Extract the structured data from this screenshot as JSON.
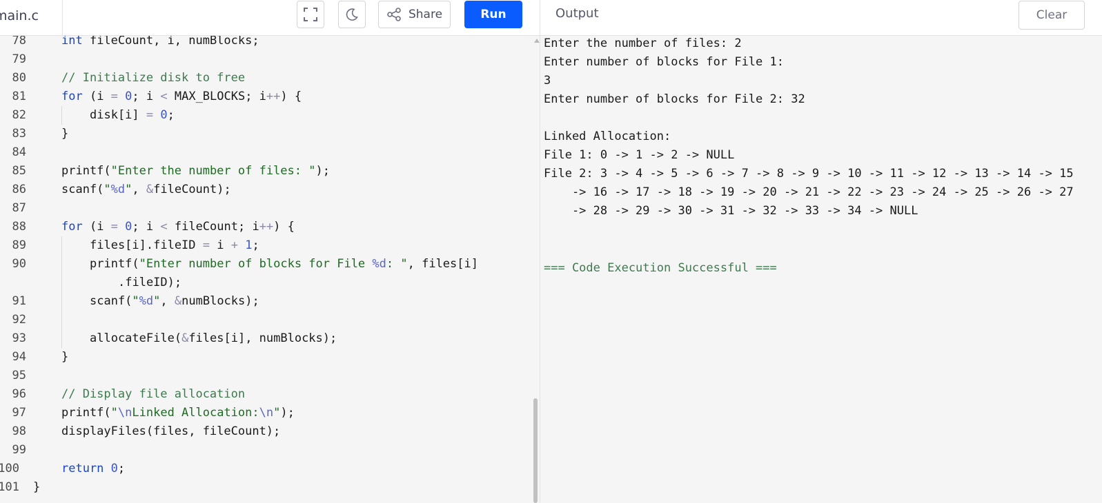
{
  "editor_tab": {
    "filename": "main.c"
  },
  "toolbar": {
    "fullscreen_icon": "fullscreen-icon",
    "theme_icon": "moon-icon",
    "share_icon": "share-icon",
    "share_label": "Share",
    "run_label": "Run",
    "run_color": "#0b5cff"
  },
  "output_panel": {
    "title": "Output",
    "clear_label": "Clear",
    "lines": [
      "Enter the number of files: 2",
      "Enter number of blocks for File 1:",
      "3",
      "Enter number of blocks for File 2: 32",
      "",
      "Linked Allocation:",
      "File 1: 0 -> 1 -> 2 -> NULL",
      "File 2: 3 -> 4 -> 5 -> 6 -> 7 -> 8 -> 9 -> 10 -> 11 -> 12 -> 13 -> 14 -> 15",
      "    -> 16 -> 17 -> 18 -> 19 -> 20 -> 21 -> 22 -> 23 -> 24 -> 25 -> 26 -> 27",
      "    -> 28 -> 29 -> 30 -> 31 -> 32 -> 33 -> 34 -> NULL"
    ],
    "status": "=== Code Execution Successful ===",
    "status_color": "#3d7a4d"
  },
  "code": {
    "lines": [
      {
        "num": "78",
        "indent": 1,
        "tokens": [
          [
            "kw",
            "int"
          ],
          [
            "pn",
            " fileCount, i, numBlocks;"
          ]
        ]
      },
      {
        "num": "79",
        "indent": 0,
        "tokens": []
      },
      {
        "num": "80",
        "indent": 1,
        "tokens": [
          [
            "cm",
            "// Initialize disk to free"
          ]
        ]
      },
      {
        "num": "81",
        "indent": 1,
        "fold": true,
        "tokens": [
          [
            "kw",
            "for"
          ],
          [
            "pn",
            " (i "
          ],
          [
            "op",
            "="
          ],
          [
            "pn",
            " "
          ],
          [
            "num",
            "0"
          ],
          [
            "pn",
            "; i "
          ],
          [
            "op",
            "<"
          ],
          [
            "pn",
            " MAX_BLOCKS; i"
          ],
          [
            "op",
            "++"
          ],
          [
            "pn",
            ") {"
          ]
        ]
      },
      {
        "num": "82",
        "indent": 2,
        "tokens": [
          [
            "pn",
            "disk[i] "
          ],
          [
            "op",
            "="
          ],
          [
            "pn",
            " "
          ],
          [
            "num",
            "0"
          ],
          [
            "pn",
            ";"
          ]
        ]
      },
      {
        "num": "83",
        "indent": 1,
        "tokens": [
          [
            "pn",
            "}"
          ]
        ]
      },
      {
        "num": "84",
        "indent": 0,
        "tokens": []
      },
      {
        "num": "85",
        "indent": 1,
        "tokens": [
          [
            "pn",
            "printf("
          ],
          [
            "str",
            "\"Enter the number of files: \""
          ],
          [
            "pn",
            ");"
          ]
        ]
      },
      {
        "num": "86",
        "indent": 1,
        "tokens": [
          [
            "pn",
            "scanf("
          ],
          [
            "str",
            "\""
          ],
          [
            "esc",
            "%d"
          ],
          [
            "str",
            "\""
          ],
          [
            "pn",
            ", "
          ],
          [
            "op",
            "&"
          ],
          [
            "pn",
            "fileCount);"
          ]
        ]
      },
      {
        "num": "87",
        "indent": 0,
        "tokens": []
      },
      {
        "num": "88",
        "indent": 1,
        "fold": true,
        "tokens": [
          [
            "kw",
            "for"
          ],
          [
            "pn",
            " (i "
          ],
          [
            "op",
            "="
          ],
          [
            "pn",
            " "
          ],
          [
            "num",
            "0"
          ],
          [
            "pn",
            "; i "
          ],
          [
            "op",
            "<"
          ],
          [
            "pn",
            " fileCount; i"
          ],
          [
            "op",
            "++"
          ],
          [
            "pn",
            ") {"
          ]
        ]
      },
      {
        "num": "89",
        "indent": 2,
        "tokens": [
          [
            "pn",
            "files[i].fileID "
          ],
          [
            "op",
            "="
          ],
          [
            "pn",
            " i "
          ],
          [
            "op",
            "+"
          ],
          [
            "pn",
            " "
          ],
          [
            "num",
            "1"
          ],
          [
            "pn",
            ";"
          ]
        ]
      },
      {
        "num": "90",
        "indent": 2,
        "tokens": [
          [
            "pn",
            "printf("
          ],
          [
            "str",
            "\"Enter number of blocks for File "
          ],
          [
            "esc",
            "%d"
          ],
          [
            "str",
            ": \""
          ],
          [
            "pn",
            ", files[i]"
          ]
        ]
      },
      {
        "num": "",
        "indent": 3,
        "tokens": [
          [
            "pn",
            ".fileID);"
          ]
        ]
      },
      {
        "num": "91",
        "indent": 2,
        "tokens": [
          [
            "pn",
            "scanf("
          ],
          [
            "str",
            "\""
          ],
          [
            "esc",
            "%d"
          ],
          [
            "str",
            "\""
          ],
          [
            "pn",
            ", "
          ],
          [
            "op",
            "&"
          ],
          [
            "pn",
            "numBlocks);"
          ]
        ]
      },
      {
        "num": "92",
        "indent": 0,
        "tokens": []
      },
      {
        "num": "93",
        "indent": 2,
        "tokens": [
          [
            "pn",
            "allocateFile("
          ],
          [
            "op",
            "&"
          ],
          [
            "pn",
            "files[i], numBlocks);"
          ]
        ]
      },
      {
        "num": "94",
        "indent": 1,
        "tokens": [
          [
            "pn",
            "}"
          ]
        ]
      },
      {
        "num": "95",
        "indent": 0,
        "tokens": []
      },
      {
        "num": "96",
        "indent": 1,
        "tokens": [
          [
            "cm",
            "// Display file allocation"
          ]
        ]
      },
      {
        "num": "97",
        "indent": 1,
        "tokens": [
          [
            "pn",
            "printf("
          ],
          [
            "str",
            "\""
          ],
          [
            "esc",
            "\\n"
          ],
          [
            "str",
            "Linked Allocation:"
          ],
          [
            "esc",
            "\\n"
          ],
          [
            "str",
            "\""
          ],
          [
            "pn",
            ");"
          ]
        ]
      },
      {
        "num": "98",
        "indent": 1,
        "tokens": [
          [
            "pn",
            "displayFiles(files, fileCount);"
          ]
        ]
      },
      {
        "num": "99",
        "indent": 0,
        "tokens": []
      },
      {
        "num": "100",
        "indent": 1,
        "tokens": [
          [
            "kw",
            "return"
          ],
          [
            "pn",
            " "
          ],
          [
            "num",
            "0"
          ],
          [
            "pn",
            ";"
          ]
        ]
      },
      {
        "num": "101",
        "indent": 0,
        "tokens": [
          [
            "pn",
            "}"
          ]
        ]
      }
    ]
  }
}
